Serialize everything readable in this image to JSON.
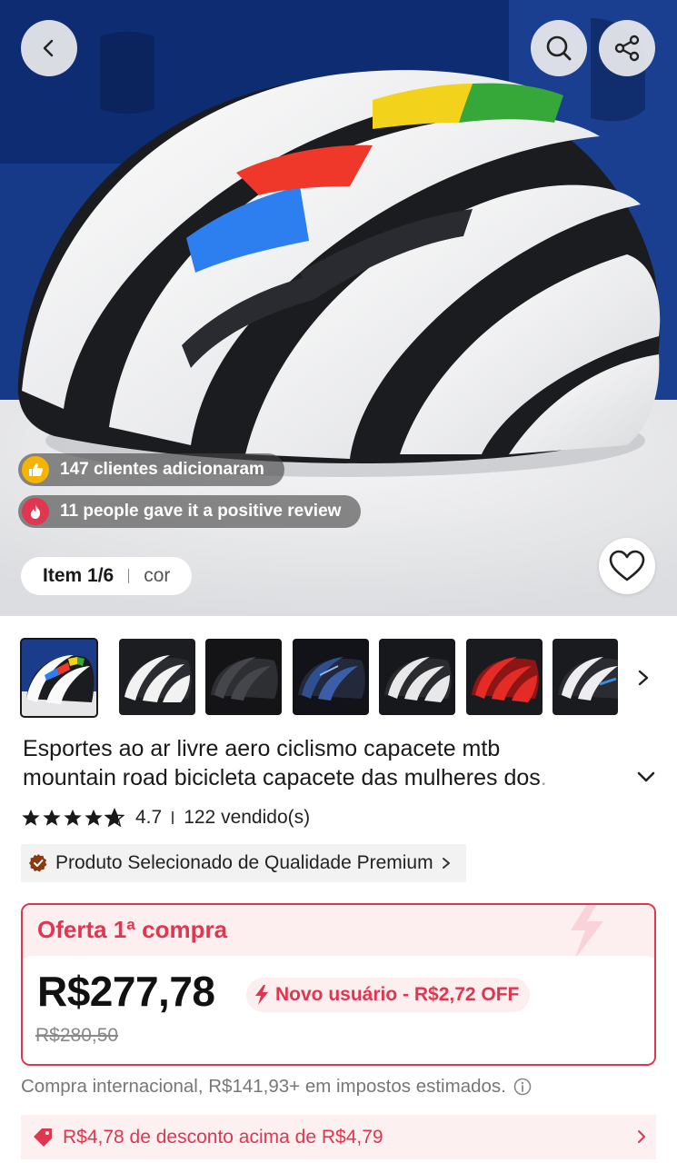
{
  "hero": {
    "added_text": "147 clientes adicionaram",
    "review_text": "11 people gave it a positive review",
    "item_counter": "Item 1/6",
    "item_variant_label": "cor",
    "icons": [
      "back-arrow-icon",
      "search-icon",
      "share-icon",
      "heart-icon",
      "thumbs-up-icon",
      "flame-icon"
    ]
  },
  "thumbnails": [
    {
      "name": "white-rainbow",
      "selected": true
    },
    {
      "name": "white-grey",
      "selected": false
    },
    {
      "name": "black",
      "selected": false
    },
    {
      "name": "dark-blue",
      "selected": false
    },
    {
      "name": "black-white",
      "selected": false
    },
    {
      "name": "red",
      "selected": false
    },
    {
      "name": "white-blue",
      "selected": false
    }
  ],
  "product": {
    "title_line1": "Esportes ao ar livre aero ciclismo capacete mtb",
    "title_line2": "mountain road bicicleta capacete das mulheres dos",
    "rating": "4.7",
    "sold": "122 vendido(s)",
    "premium_label": "Produto Selecionado de Qualidade Premium"
  },
  "offer": {
    "title": "Oferta 1ª compra",
    "price": "R$277,78",
    "original_price": "R$280,50",
    "new_user_label": "Novo usuário - R$2,72 OFF"
  },
  "tax_note": "Compra internacional, R$141,93+ em impostos estimados.",
  "discount": "R$4,78 de desconto acima de R$4,79",
  "colors": {
    "accent_red": "#e0364f",
    "accent_bg": "#fdeef0",
    "star": "#191919",
    "badge_brown": "#8a3a10"
  }
}
